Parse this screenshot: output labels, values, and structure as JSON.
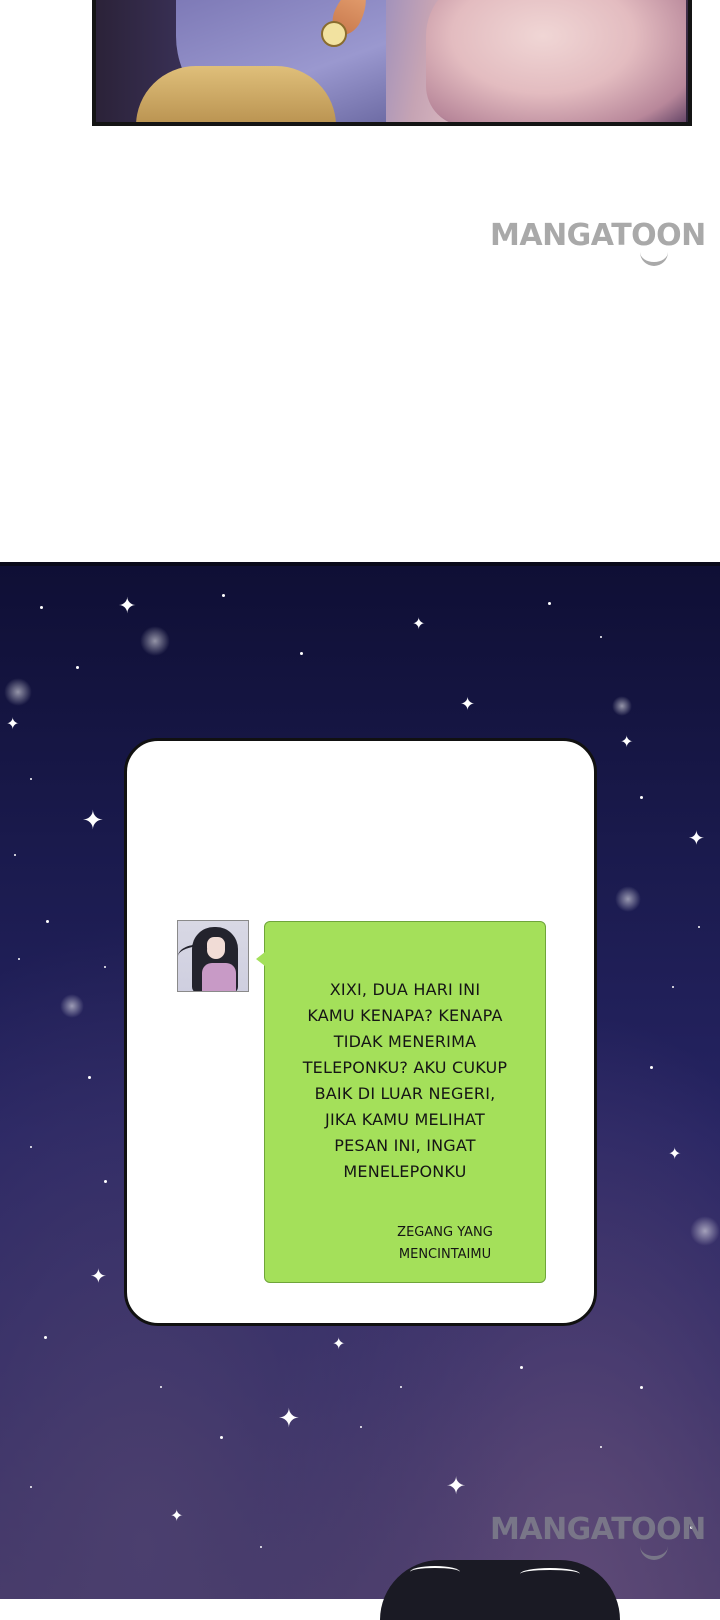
{
  "watermarks": [
    {
      "text": "MANGATOON"
    },
    {
      "text": "MANGATOON"
    }
  ],
  "message": {
    "body": "XIXI, DUA HARI INI\nKAMU KENAPA? KENAPA\nTIDAK MENERIMA\nTELEPONKU? AKU CUKUP\nBAIK DI LUAR NEGERI,\nJIKA KAMU MELIHAT\nPESAN INI, INGAT\nMENELEPONKU",
    "signature": "ZEGANG YANG\nMENCINTAIMU",
    "bubble_color": "#a4e05a"
  },
  "colors": {
    "sky_top": "#0f0f35",
    "sky_bottom": "#433766",
    "watermark": "#a9a9a9"
  }
}
